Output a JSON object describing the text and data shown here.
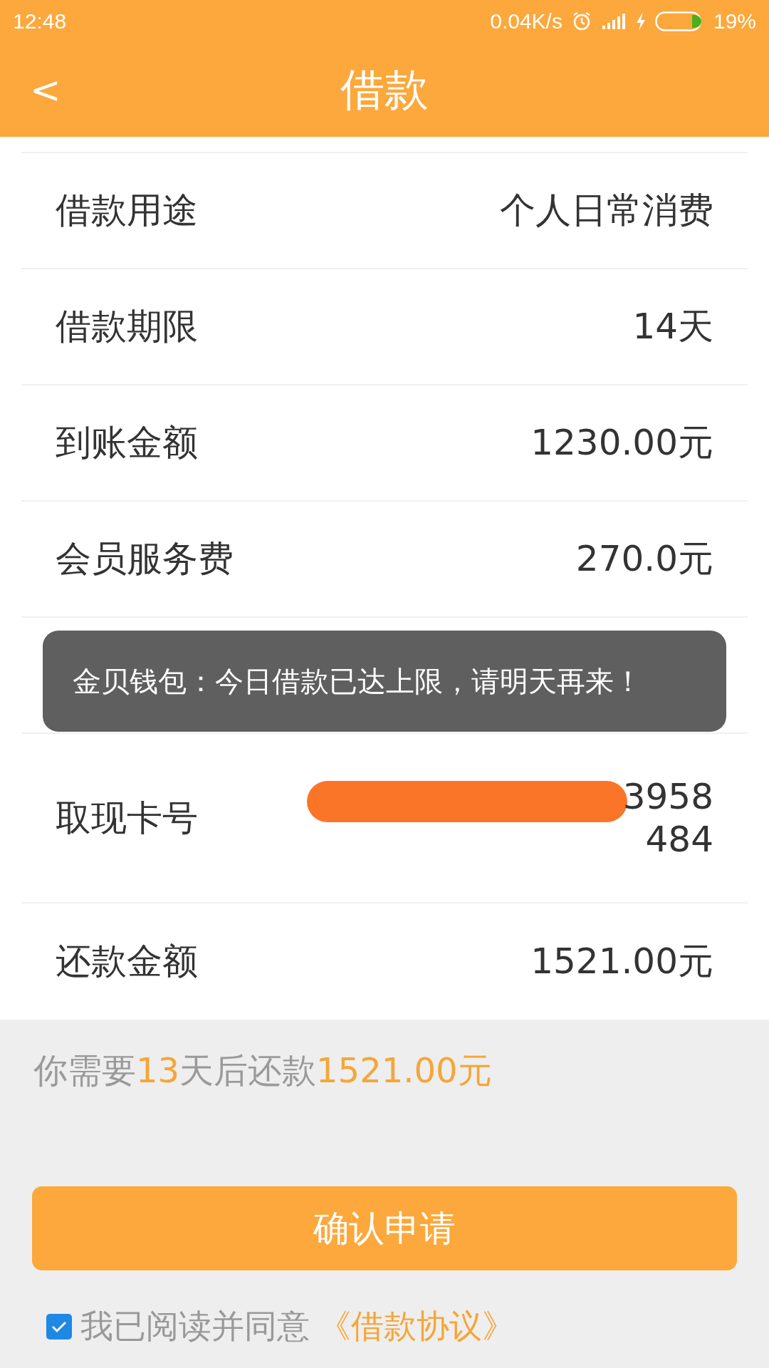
{
  "status_bar": {
    "time": "12:48",
    "speed": "0.04K/s",
    "battery": "19%"
  },
  "header": {
    "back": "<",
    "title": "借款"
  },
  "rows": [
    {
      "kind": "partial"
    },
    {
      "kind": "text",
      "label": "借款用途",
      "value": "个人日常消费"
    },
    {
      "kind": "text",
      "label": "借款期限",
      "value": "14天"
    },
    {
      "kind": "text",
      "label": "到账金额",
      "value": "1230.00元"
    },
    {
      "kind": "text",
      "label": "会员服务费",
      "value": "270.0元"
    },
    {
      "kind": "covered"
    },
    {
      "kind": "card",
      "label": "取现卡号",
      "value_lines": [
        "3958",
        "484"
      ]
    },
    {
      "kind": "text",
      "label": "还款金额",
      "value": "1521.00元"
    }
  ],
  "toast": {
    "text": "金贝钱包：今日借款已达上限，请明天再来！"
  },
  "summary": [
    {
      "kind": "plain",
      "text": "你需要"
    },
    {
      "kind": "highlight",
      "text": "13"
    },
    {
      "kind": "plain",
      "text": "天后还款"
    },
    {
      "kind": "highlight",
      "text": "1521.00元"
    }
  ],
  "confirm_button": "确认申请",
  "agreement": {
    "checked": true,
    "text": "我已阅读并同意",
    "link": "《借款协议》"
  }
}
